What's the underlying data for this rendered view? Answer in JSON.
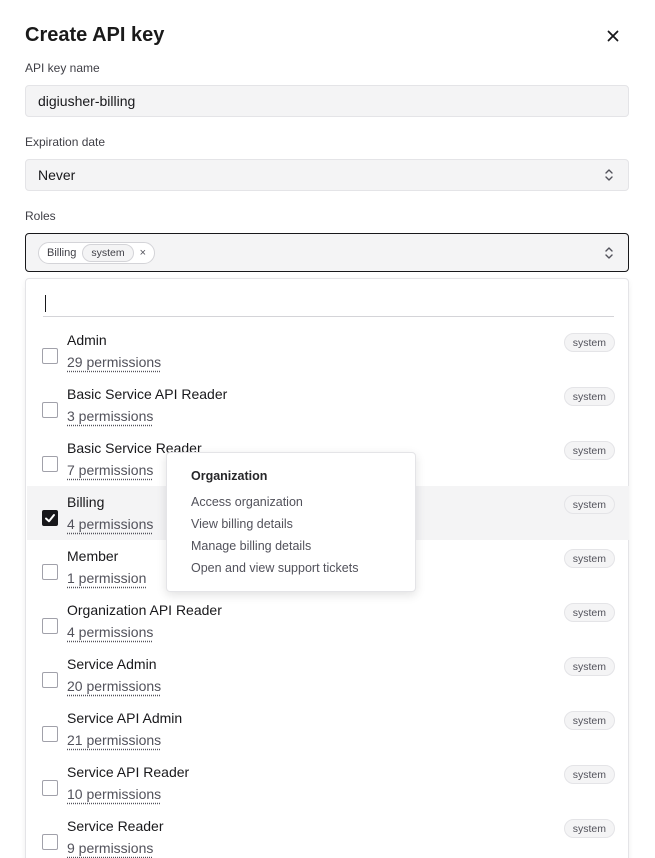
{
  "dialog": {
    "title": "Create API key"
  },
  "form": {
    "name_label": "API key name",
    "name_value": "digiusher-billing",
    "expiration_label": "Expiration date",
    "expiration_value": "Never",
    "roles_label": "Roles"
  },
  "selected_chip": {
    "name": "Billing",
    "badge": "system",
    "remove": "×"
  },
  "roles": [
    {
      "name": "Admin",
      "permissions": "29 permissions",
      "badge": "system",
      "checked": false
    },
    {
      "name": "Basic Service API Reader",
      "permissions": "3 permissions",
      "badge": "system",
      "checked": false
    },
    {
      "name": "Basic Service Reader",
      "permissions": "7 permissions",
      "badge": "system",
      "checked": false
    },
    {
      "name": "Billing",
      "permissions": "4 permissions",
      "badge": "system",
      "checked": true
    },
    {
      "name": "Member",
      "permissions": "1 permission",
      "badge": "system",
      "checked": false
    },
    {
      "name": "Organization API Reader",
      "permissions": "4 permissions",
      "badge": "system",
      "checked": false
    },
    {
      "name": "Service Admin",
      "permissions": "20 permissions",
      "badge": "system",
      "checked": false
    },
    {
      "name": "Service API Admin",
      "permissions": "21 permissions",
      "badge": "system",
      "checked": false
    },
    {
      "name": "Service API Reader",
      "permissions": "10 permissions",
      "badge": "system",
      "checked": false
    },
    {
      "name": "Service Reader",
      "permissions": "9 permissions",
      "badge": "system",
      "checked": false
    }
  ],
  "tooltip": {
    "heading": "Organization",
    "items": [
      "Access organization",
      "View billing details",
      "Manage billing details",
      "Open and view support tickets"
    ]
  },
  "icons": {
    "close": "close-icon",
    "updown": "chevron-up-down-icon",
    "check": "check-icon"
  }
}
